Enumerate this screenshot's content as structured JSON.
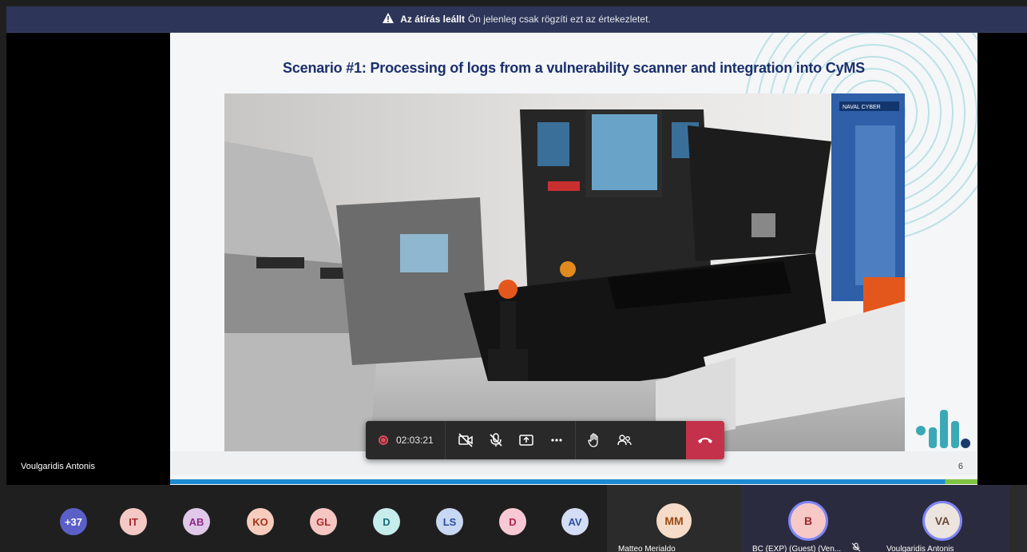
{
  "banner": {
    "bold": "Az átírás leállt",
    "text": "Ön jelenleg csak rögzíti ezt az értekezletet."
  },
  "slide": {
    "title": "Scenario #1: Processing of logs from a vulnerability scanner and integration into CyMS",
    "page_number": "6",
    "photo_sign": "NAVAL CYBER"
  },
  "speaker": {
    "name": "Voulgaridis Antonis"
  },
  "callbar": {
    "timer": "02:03:21",
    "icons": [
      "record-icon",
      "camera-off-icon",
      "mic-off-icon",
      "share-icon",
      "more-icon",
      "raise-hand-icon",
      "people-icon",
      "hangup-icon"
    ]
  },
  "participants": [
    {
      "initials": "+37",
      "bg": "#5b5fc7",
      "fg": "#ffffff"
    },
    {
      "initials": "IT",
      "bg": "#f4c8c4",
      "fg": "#a4262c"
    },
    {
      "initials": "AB",
      "bg": "#e0c8e8",
      "fg": "#8a2c8a"
    },
    {
      "initials": "KO",
      "bg": "#f6cdbd",
      "fg": "#a0331a"
    },
    {
      "initials": "GL",
      "bg": "#f6c6c2",
      "fg": "#b02a2a"
    },
    {
      "initials": "D",
      "bg": "#c6ecec",
      "fg": "#1a6f7a"
    },
    {
      "initials": "LS",
      "bg": "#c9d8f2",
      "fg": "#2b4ea0"
    },
    {
      "initials": "D",
      "bg": "#f8c9d4",
      "fg": "#b0244f"
    },
    {
      "initials": "AV",
      "bg": "#d3ddf5",
      "fg": "#2f4fa0"
    }
  ],
  "tiles": [
    {
      "initials": "MM",
      "name": "Matteo Merialdo",
      "bg": "#f6dcc8",
      "fg": "#9a4a12"
    },
    {
      "initials": "B",
      "name": "BC (EXP) (Guest) (Ven...",
      "bg": "#f6c9c6",
      "fg": "#a0262c"
    },
    {
      "initials": "VA",
      "name": "Voulgaridis Antonis",
      "bg": "#ece4df",
      "fg": "#6a4a3a"
    }
  ],
  "colors": {
    "banner_bg": "#2d3558",
    "hangup": "#c4314b",
    "title_blue": "#1a2f6b",
    "accent_ring": "#7f85f5"
  }
}
